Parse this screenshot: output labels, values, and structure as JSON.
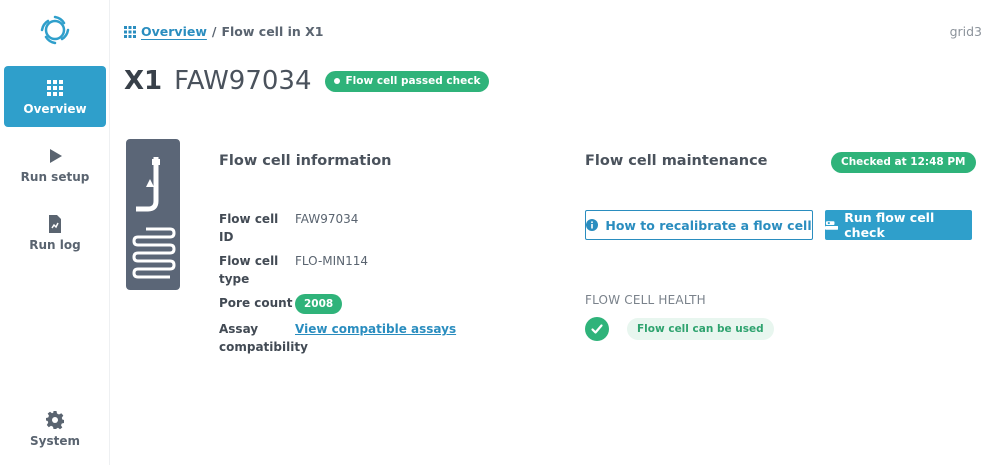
{
  "sidebar": {
    "items": [
      {
        "label": "Overview",
        "icon": "grid-icon",
        "active": true
      },
      {
        "label": "Run setup",
        "icon": "play-icon"
      },
      {
        "label": "Run log",
        "icon": "document-icon"
      },
      {
        "label": "System",
        "icon": "gear-icon"
      }
    ]
  },
  "breadcrumb": {
    "link": "Overview",
    "separator": "/",
    "current": "Flow cell in X1"
  },
  "host": "grid3",
  "header": {
    "position": "X1",
    "flow_cell_id": "FAW97034",
    "status_badge": "Flow cell passed check"
  },
  "info": {
    "title": "Flow cell information",
    "rows": [
      {
        "key": "Flow cell ID",
        "value": "FAW97034"
      },
      {
        "key": "Flow cell type",
        "value": "FLO-MIN114"
      },
      {
        "key": "Pore count",
        "value": "2008"
      },
      {
        "key": "Assay compatibility",
        "value": "View compatible assays"
      }
    ]
  },
  "maintenance": {
    "title": "Flow cell maintenance",
    "checked_badge": "Checked at 12:48 PM",
    "recalibrate_button": "How to recalibrate a flow cell",
    "run_check_button": "Run flow cell check",
    "health_label": "FLOW CELL HEALTH",
    "health_status": "Flow cell can be used"
  },
  "colors": {
    "accent": "#2f9fcb",
    "link": "#2a8dbf",
    "success": "#2fb37a",
    "text": "#424a54"
  }
}
